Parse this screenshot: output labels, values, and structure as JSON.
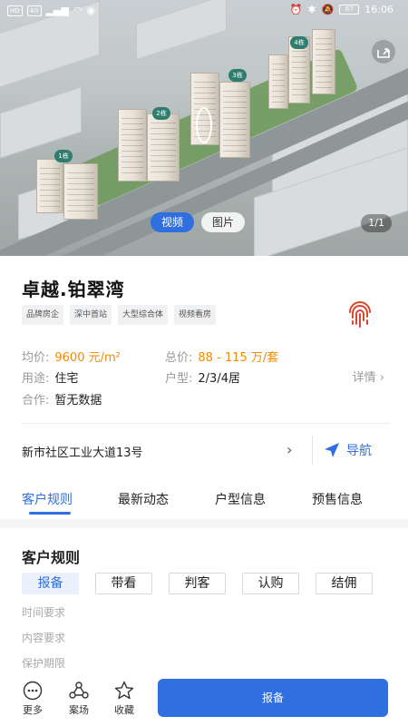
{
  "status_bar": {
    "left_chip_1": "HD",
    "left_chip_2": "4G",
    "time": "16:06",
    "battery": "67"
  },
  "hero": {
    "building_tags": [
      "1栋",
      "2栋",
      "3栋",
      "4栋"
    ],
    "media_tabs": [
      {
        "label": "视频",
        "active": true
      },
      {
        "label": "图片",
        "active": false
      }
    ],
    "counter": "1/1"
  },
  "project": {
    "name": "卓越.铂翠湾",
    "tags": [
      "品牌房企",
      "深中首站",
      "大型综合体",
      "视频看房"
    ],
    "avg_price_label": "均价:",
    "avg_price": "9600 元/m²",
    "total_price_label": "总价:",
    "total_price": "88 - 115 万/套",
    "usage_label": "用途:",
    "usage": "住宅",
    "layout_label": "户型:",
    "layout": "2/3/4居",
    "cooperation_label": "合作:",
    "cooperation": "暂无数据",
    "detail_link": "详情",
    "address": "新市社区工业大道13号",
    "navigate": "导航"
  },
  "tabs": [
    {
      "label": "客户规则",
      "active": true
    },
    {
      "label": "最新动态",
      "active": false
    },
    {
      "label": "户型信息",
      "active": false
    },
    {
      "label": "预售信息",
      "active": false
    }
  ],
  "customer_rules": {
    "title": "客户规则",
    "options": [
      {
        "label": "报备",
        "active": true
      },
      {
        "label": "带看",
        "active": false
      },
      {
        "label": "判客",
        "active": false
      },
      {
        "label": "认购",
        "active": false
      },
      {
        "label": "结佣",
        "active": false
      }
    ],
    "requirements": [
      "时间要求",
      "内容要求",
      "保护期限"
    ]
  },
  "bottom_bar": {
    "more": "更多",
    "case": "案场",
    "favorite": "收藏",
    "report_button": "报备"
  },
  "colors": {
    "primary": "#2f6fe0",
    "price": "#f08a00",
    "fingerprint": "#e0442b"
  }
}
